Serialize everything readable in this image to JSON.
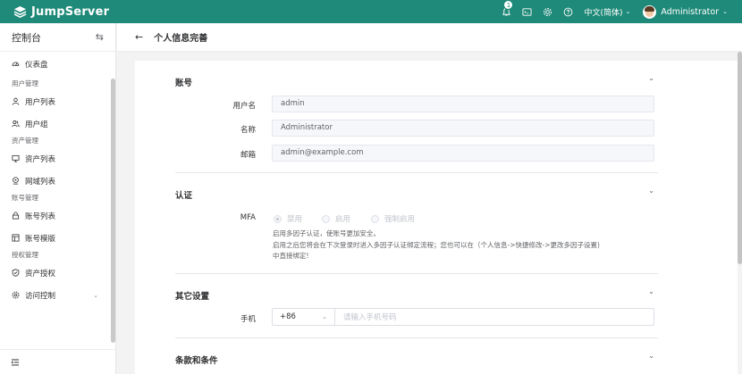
{
  "header": {
    "brand": "JumpServer",
    "notification_count": "1",
    "icons": [
      "bell-icon",
      "terminal-icon",
      "settings-icon",
      "help-icon"
    ],
    "language": "中文(简体)",
    "user_name": "Administrator",
    "bg_color": "#1f8a79"
  },
  "sidebar": {
    "title": "控制台",
    "items": [
      {
        "type": "item",
        "label": "仪表盘",
        "icon": "dashboard-icon"
      },
      {
        "type": "group",
        "label": "用户管理"
      },
      {
        "type": "item",
        "label": "用户列表",
        "icon": "user-icon"
      },
      {
        "type": "item",
        "label": "用户组",
        "icon": "user-group-icon"
      },
      {
        "type": "group",
        "label": "资产管理"
      },
      {
        "type": "item",
        "label": "资产列表",
        "icon": "monitor-icon"
      },
      {
        "type": "item",
        "label": "网域列表",
        "icon": "location-icon"
      },
      {
        "type": "group",
        "label": "账号管理"
      },
      {
        "type": "item",
        "label": "账号列表",
        "icon": "lock-icon"
      },
      {
        "type": "item",
        "label": "账号模版",
        "icon": "template-icon"
      },
      {
        "type": "group",
        "label": "授权管理"
      },
      {
        "type": "item",
        "label": "资产授权",
        "icon": "shield-icon"
      },
      {
        "type": "item",
        "label": "访问控制",
        "icon": "access-control-icon",
        "has_arrow": true
      }
    ]
  },
  "page": {
    "title": "个人信息完善"
  },
  "account": {
    "title": "账号",
    "username_label": "用户名",
    "username_value": "admin",
    "name_label": "名称",
    "name_value": "Administrator",
    "email_label": "邮箱",
    "email_value": "admin@example.com"
  },
  "auth": {
    "title": "认证",
    "mfa_label": "MFA",
    "options": [
      "禁用",
      "启用",
      "强制启用"
    ],
    "selected": "禁用",
    "help_lines": [
      "启用多因子认证，使账号更加安全。",
      "启用之后您将会在下次登录时进入多因子认证绑定流程；您也可以在（个人信息->快捷修改->更改多因子设置)",
      "中直接绑定!"
    ]
  },
  "other": {
    "title": "其它设置",
    "phone_label": "手机",
    "phone_code": "+86",
    "phone_placeholder": "请输入手机号码"
  },
  "terms": {
    "title": "条款和条件"
  }
}
